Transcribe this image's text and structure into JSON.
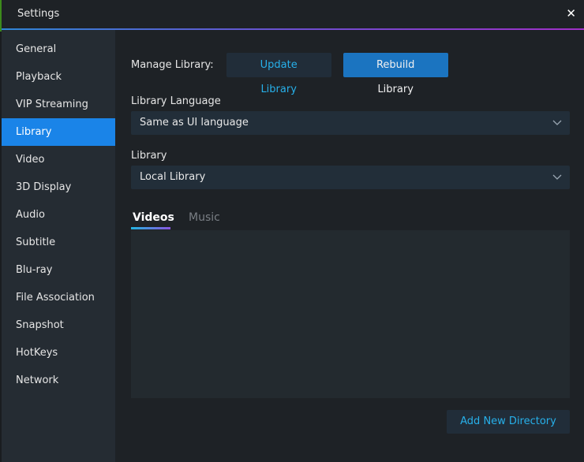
{
  "window": {
    "title": "Settings",
    "close_label": "✕"
  },
  "sidebar": {
    "items": [
      {
        "label": "General",
        "active": false
      },
      {
        "label": "Playback",
        "active": false
      },
      {
        "label": "VIP Streaming",
        "active": false
      },
      {
        "label": "Library",
        "active": true
      },
      {
        "label": "Video",
        "active": false
      },
      {
        "label": "3D Display",
        "active": false
      },
      {
        "label": "Audio",
        "active": false
      },
      {
        "label": "Subtitle",
        "active": false
      },
      {
        "label": "Blu-ray",
        "active": false
      },
      {
        "label": "File Association",
        "active": false
      },
      {
        "label": "Snapshot",
        "active": false
      },
      {
        "label": "HotKeys",
        "active": false
      },
      {
        "label": "Network",
        "active": false
      }
    ]
  },
  "main": {
    "manage_label": "Manage Library:",
    "update_button": "Update Library",
    "rebuild_button": "Rebuild Library",
    "language_label": "Library Language",
    "language_value": "Same as UI language",
    "library_label": "Library",
    "library_value": "Local Library",
    "tabs": [
      {
        "label": "Videos",
        "active": true
      },
      {
        "label": "Music",
        "active": false
      }
    ],
    "add_directory_button": "Add New Directory"
  },
  "colors": {
    "accent": "#1a84e8",
    "link": "#27b0ea",
    "background": "#1e2226",
    "sidebar": "#252c33"
  }
}
